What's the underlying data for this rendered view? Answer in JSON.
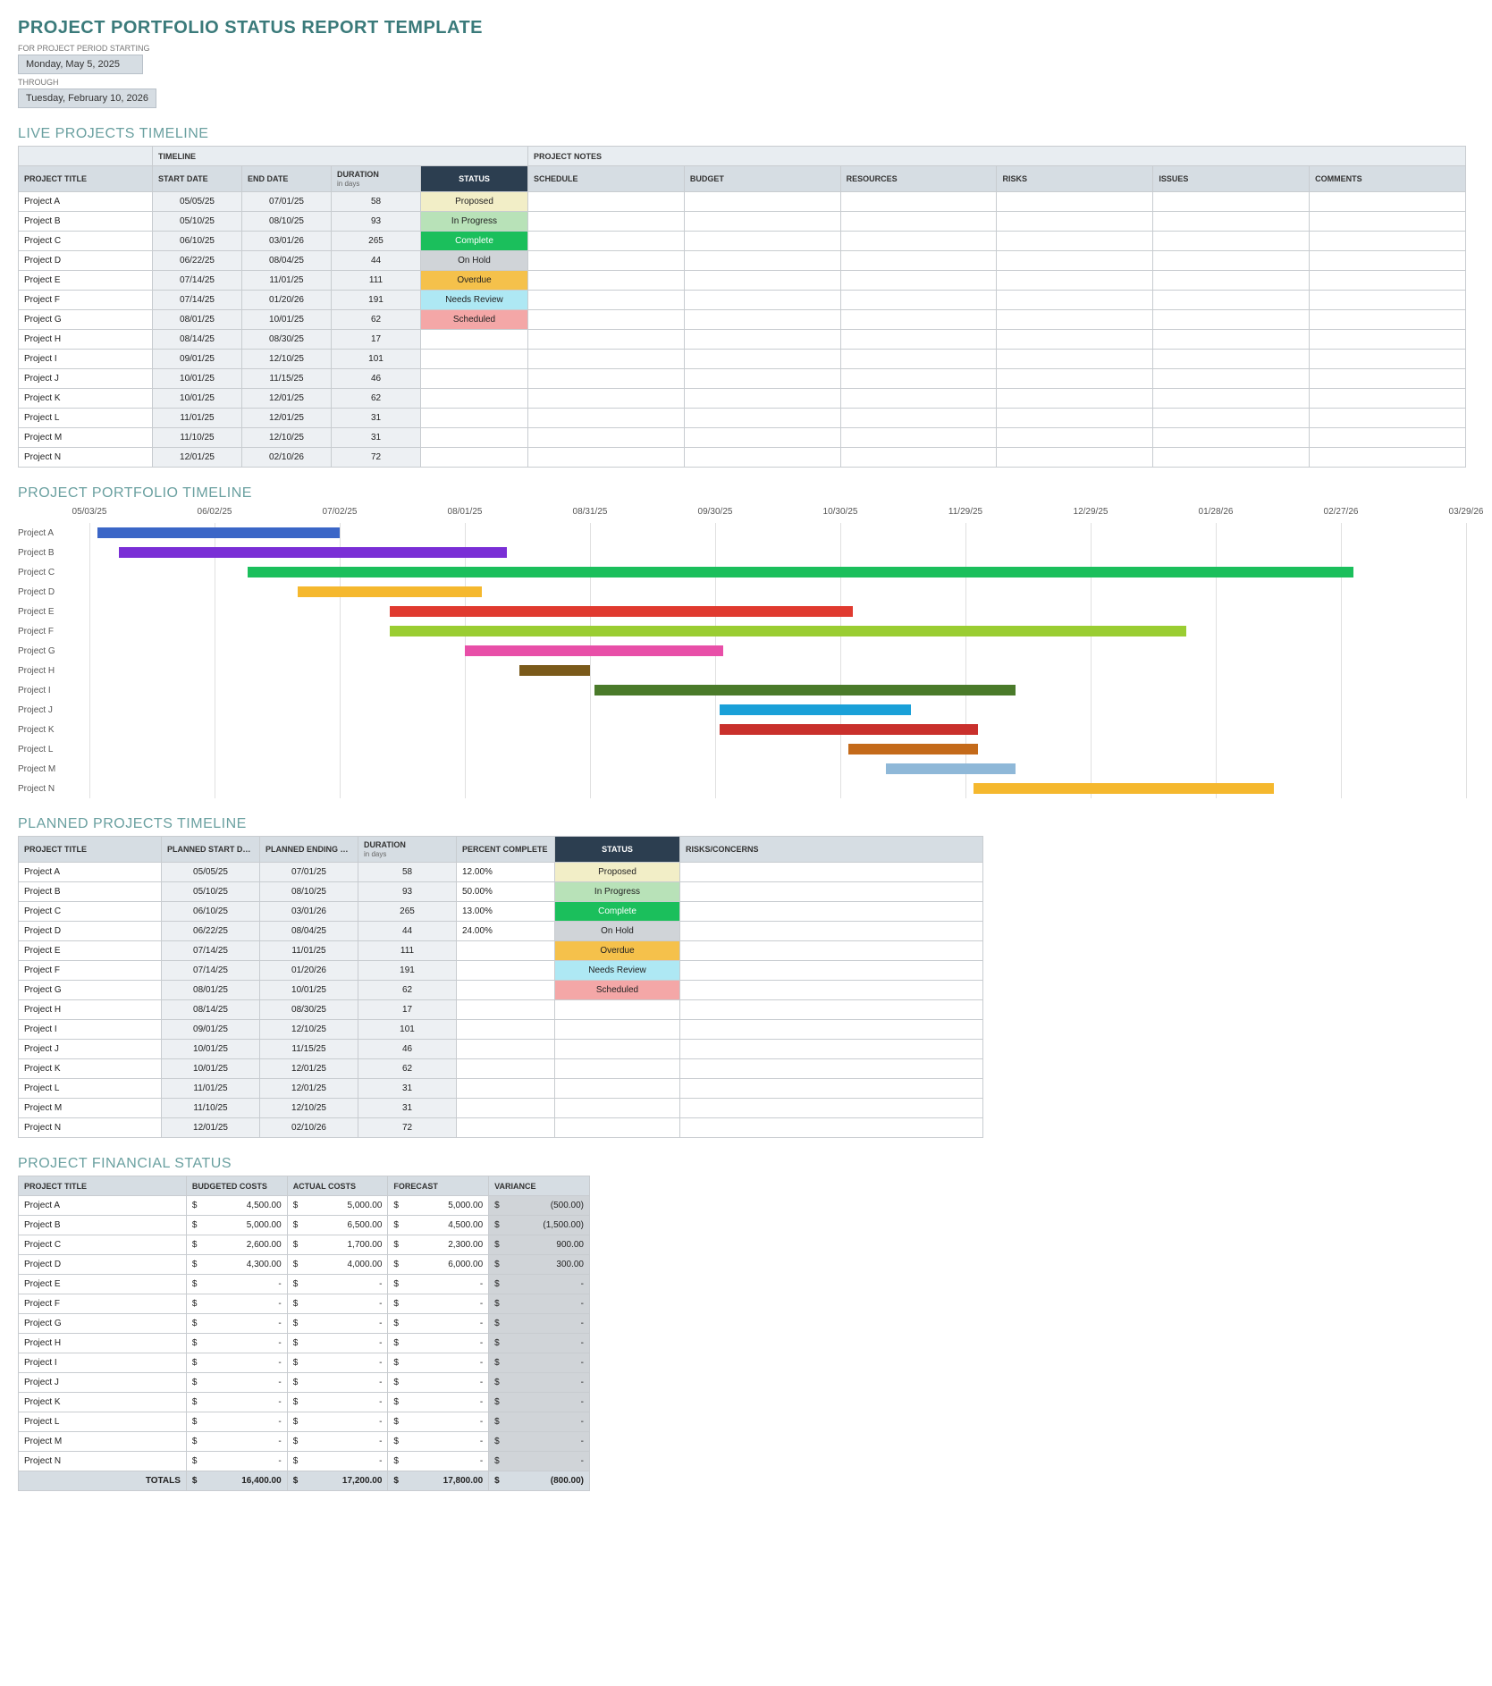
{
  "title": "PROJECT PORTFOLIO STATUS REPORT TEMPLATE",
  "period": {
    "starting_label": "FOR PROJECT PERIOD STARTING",
    "starting_value": "Monday, May 5, 2025",
    "through_label": "THROUGH",
    "through_value": "Tuesday, February 10, 2026"
  },
  "sections": {
    "live": "LIVE PROJECTS TIMELINE",
    "gantt": "PROJECT PORTFOLIO TIMELINE",
    "planned": "PLANNED PROJECTS TIMELINE",
    "financial": "PROJECT FINANCIAL STATUS"
  },
  "live_headers": {
    "timeline_section": "TIMELINE",
    "notes_section": "PROJECT NOTES",
    "project_title": "PROJECT TITLE",
    "start_date": "START DATE",
    "end_date": "END DATE",
    "duration": "DURATION",
    "duration_sub": "in days",
    "status": "STATUS",
    "schedule": "SCHEDULE",
    "budget": "BUDGET",
    "resources": "RESOURCES",
    "risks": "RISKS",
    "issues": "ISSUES",
    "comments": "COMMENTS"
  },
  "live_rows": [
    {
      "title": "Project A",
      "start": "05/05/25",
      "end": "07/01/25",
      "dur": "58",
      "status": "Proposed",
      "status_class": "st-proposed"
    },
    {
      "title": "Project B",
      "start": "05/10/25",
      "end": "08/10/25",
      "dur": "93",
      "status": "In Progress",
      "status_class": "st-inprogress"
    },
    {
      "title": "Project C",
      "start": "06/10/25",
      "end": "03/01/26",
      "dur": "265",
      "status": "Complete",
      "status_class": "st-complete"
    },
    {
      "title": "Project D",
      "start": "06/22/25",
      "end": "08/04/25",
      "dur": "44",
      "status": "On Hold",
      "status_class": "st-onhold"
    },
    {
      "title": "Project E",
      "start": "07/14/25",
      "end": "11/01/25",
      "dur": "111",
      "status": "Overdue",
      "status_class": "st-overdue"
    },
    {
      "title": "Project F",
      "start": "07/14/25",
      "end": "01/20/26",
      "dur": "191",
      "status": "Needs Review",
      "status_class": "st-needsreview"
    },
    {
      "title": "Project G",
      "start": "08/01/25",
      "end": "10/01/25",
      "dur": "62",
      "status": "Scheduled",
      "status_class": "st-scheduled"
    },
    {
      "title": "Project H",
      "start": "08/14/25",
      "end": "08/30/25",
      "dur": "17",
      "status": "",
      "status_class": ""
    },
    {
      "title": "Project I",
      "start": "09/01/25",
      "end": "12/10/25",
      "dur": "101",
      "status": "",
      "status_class": ""
    },
    {
      "title": "Project J",
      "start": "10/01/25",
      "end": "11/15/25",
      "dur": "46",
      "status": "",
      "status_class": ""
    },
    {
      "title": "Project K",
      "start": "10/01/25",
      "end": "12/01/25",
      "dur": "62",
      "status": "",
      "status_class": ""
    },
    {
      "title": "Project L",
      "start": "11/01/25",
      "end": "12/01/25",
      "dur": "31",
      "status": "",
      "status_class": ""
    },
    {
      "title": "Project M",
      "start": "11/10/25",
      "end": "12/10/25",
      "dur": "31",
      "status": "",
      "status_class": ""
    },
    {
      "title": "Project N",
      "start": "12/01/25",
      "end": "02/10/26",
      "dur": "72",
      "status": "",
      "status_class": ""
    }
  ],
  "planned_headers": {
    "project_title": "PROJECT TITLE",
    "planned_start": "PLANNED START DATE",
    "planned_end": "PLANNED ENDING DATE",
    "duration": "DURATION",
    "duration_sub": "in days",
    "percent": "PERCENT COMPLETE",
    "status": "STATUS",
    "risks": "RISKS/CONCERNS"
  },
  "planned_rows": [
    {
      "title": "Project A",
      "start": "05/05/25",
      "end": "07/01/25",
      "dur": "58",
      "pct": "12.00%",
      "status": "Proposed",
      "status_class": "st-proposed"
    },
    {
      "title": "Project B",
      "start": "05/10/25",
      "end": "08/10/25",
      "dur": "93",
      "pct": "50.00%",
      "status": "In Progress",
      "status_class": "st-inprogress"
    },
    {
      "title": "Project C",
      "start": "06/10/25",
      "end": "03/01/26",
      "dur": "265",
      "pct": "13.00%",
      "status": "Complete",
      "status_class": "st-complete"
    },
    {
      "title": "Project D",
      "start": "06/22/25",
      "end": "08/04/25",
      "dur": "44",
      "pct": "24.00%",
      "status": "On Hold",
      "status_class": "st-onhold"
    },
    {
      "title": "Project E",
      "start": "07/14/25",
      "end": "11/01/25",
      "dur": "111",
      "pct": "",
      "status": "Overdue",
      "status_class": "st-overdue"
    },
    {
      "title": "Project F",
      "start": "07/14/25",
      "end": "01/20/26",
      "dur": "191",
      "pct": "",
      "status": "Needs Review",
      "status_class": "st-needsreview"
    },
    {
      "title": "Project G",
      "start": "08/01/25",
      "end": "10/01/25",
      "dur": "62",
      "pct": "",
      "status": "Scheduled",
      "status_class": "st-scheduled"
    },
    {
      "title": "Project H",
      "start": "08/14/25",
      "end": "08/30/25",
      "dur": "17",
      "pct": "",
      "status": "",
      "status_class": ""
    },
    {
      "title": "Project I",
      "start": "09/01/25",
      "end": "12/10/25",
      "dur": "101",
      "pct": "",
      "status": "",
      "status_class": ""
    },
    {
      "title": "Project J",
      "start": "10/01/25",
      "end": "11/15/25",
      "dur": "46",
      "pct": "",
      "status": "",
      "status_class": ""
    },
    {
      "title": "Project K",
      "start": "10/01/25",
      "end": "12/01/25",
      "dur": "62",
      "pct": "",
      "status": "",
      "status_class": ""
    },
    {
      "title": "Project L",
      "start": "11/01/25",
      "end": "12/01/25",
      "dur": "31",
      "pct": "",
      "status": "",
      "status_class": ""
    },
    {
      "title": "Project M",
      "start": "11/10/25",
      "end": "12/10/25",
      "dur": "31",
      "pct": "",
      "status": "",
      "status_class": ""
    },
    {
      "title": "Project N",
      "start": "12/01/25",
      "end": "02/10/26",
      "dur": "72",
      "pct": "",
      "status": "",
      "status_class": ""
    }
  ],
  "fin_headers": {
    "project_title": "PROJECT TITLE",
    "budgeted": "BUDGETED COSTS",
    "actual": "ACTUAL COSTS",
    "forecast": "FORECAST",
    "variance": "VARIANCE"
  },
  "fin_rows": [
    {
      "title": "Project A",
      "b": "4,500.00",
      "a": "5,000.00",
      "f": "5,000.00",
      "v": "(500.00)"
    },
    {
      "title": "Project B",
      "b": "5,000.00",
      "a": "6,500.00",
      "f": "4,500.00",
      "v": "(1,500.00)"
    },
    {
      "title": "Project C",
      "b": "2,600.00",
      "a": "1,700.00",
      "f": "2,300.00",
      "v": "900.00"
    },
    {
      "title": "Project D",
      "b": "4,300.00",
      "a": "4,000.00",
      "f": "6,000.00",
      "v": "300.00"
    },
    {
      "title": "Project E",
      "b": "-",
      "a": "-",
      "f": "-",
      "v": "-"
    },
    {
      "title": "Project F",
      "b": "-",
      "a": "-",
      "f": "-",
      "v": "-"
    },
    {
      "title": "Project G",
      "b": "-",
      "a": "-",
      "f": "-",
      "v": "-"
    },
    {
      "title": "Project H",
      "b": "-",
      "a": "-",
      "f": "-",
      "v": "-"
    },
    {
      "title": "Project I",
      "b": "-",
      "a": "-",
      "f": "-",
      "v": "-"
    },
    {
      "title": "Project J",
      "b": "-",
      "a": "-",
      "f": "-",
      "v": "-"
    },
    {
      "title": "Project K",
      "b": "-",
      "a": "-",
      "f": "-",
      "v": "-"
    },
    {
      "title": "Project L",
      "b": "-",
      "a": "-",
      "f": "-",
      "v": "-"
    },
    {
      "title": "Project M",
      "b": "-",
      "a": "-",
      "f": "-",
      "v": "-"
    },
    {
      "title": "Project N",
      "b": "-",
      "a": "-",
      "f": "-",
      "v": "-"
    }
  ],
  "fin_totals": {
    "label": "TOTALS",
    "b": "16,400.00",
    "a": "17,200.00",
    "f": "17,800.00",
    "v": "(800.00)"
  },
  "currency_symbol": "$",
  "chart_data": {
    "type": "bar",
    "title": "PROJECT PORTFOLIO TIMELINE",
    "xlabel": "",
    "ylabel": "",
    "x_ticks": [
      "05/03/25",
      "06/02/25",
      "07/02/25",
      "08/01/25",
      "08/31/25",
      "09/30/25",
      "10/30/25",
      "11/29/25",
      "12/29/25",
      "01/28/26",
      "02/27/26",
      "03/29/26"
    ],
    "x_min_days": 0,
    "x_max_days": 330,
    "series": [
      {
        "name": "Project A",
        "start_days": 2,
        "duration": 58,
        "color": "#3b66c7"
      },
      {
        "name": "Project B",
        "start_days": 7,
        "duration": 93,
        "color": "#7a2fd6"
      },
      {
        "name": "Project C",
        "start_days": 38,
        "duration": 265,
        "color": "#1bbf5c"
      },
      {
        "name": "Project D",
        "start_days": 50,
        "duration": 44,
        "color": "#f5b82e"
      },
      {
        "name": "Project E",
        "start_days": 72,
        "duration": 111,
        "color": "#e03a2f"
      },
      {
        "name": "Project F",
        "start_days": 72,
        "duration": 191,
        "color": "#9acd32"
      },
      {
        "name": "Project G",
        "start_days": 90,
        "duration": 62,
        "color": "#e84fa8"
      },
      {
        "name": "Project H",
        "start_days": 103,
        "duration": 17,
        "color": "#7a5a1a"
      },
      {
        "name": "Project I",
        "start_days": 121,
        "duration": 101,
        "color": "#4a7a2a"
      },
      {
        "name": "Project J",
        "start_days": 151,
        "duration": 46,
        "color": "#1aa0d8"
      },
      {
        "name": "Project K",
        "start_days": 151,
        "duration": 62,
        "color": "#c9302c"
      },
      {
        "name": "Project L",
        "start_days": 182,
        "duration": 31,
        "color": "#c46a1a"
      },
      {
        "name": "Project M",
        "start_days": 191,
        "duration": 31,
        "color": "#8fb8d8"
      },
      {
        "name": "Project N",
        "start_days": 212,
        "duration": 72,
        "color": "#f5b82e"
      }
    ]
  }
}
